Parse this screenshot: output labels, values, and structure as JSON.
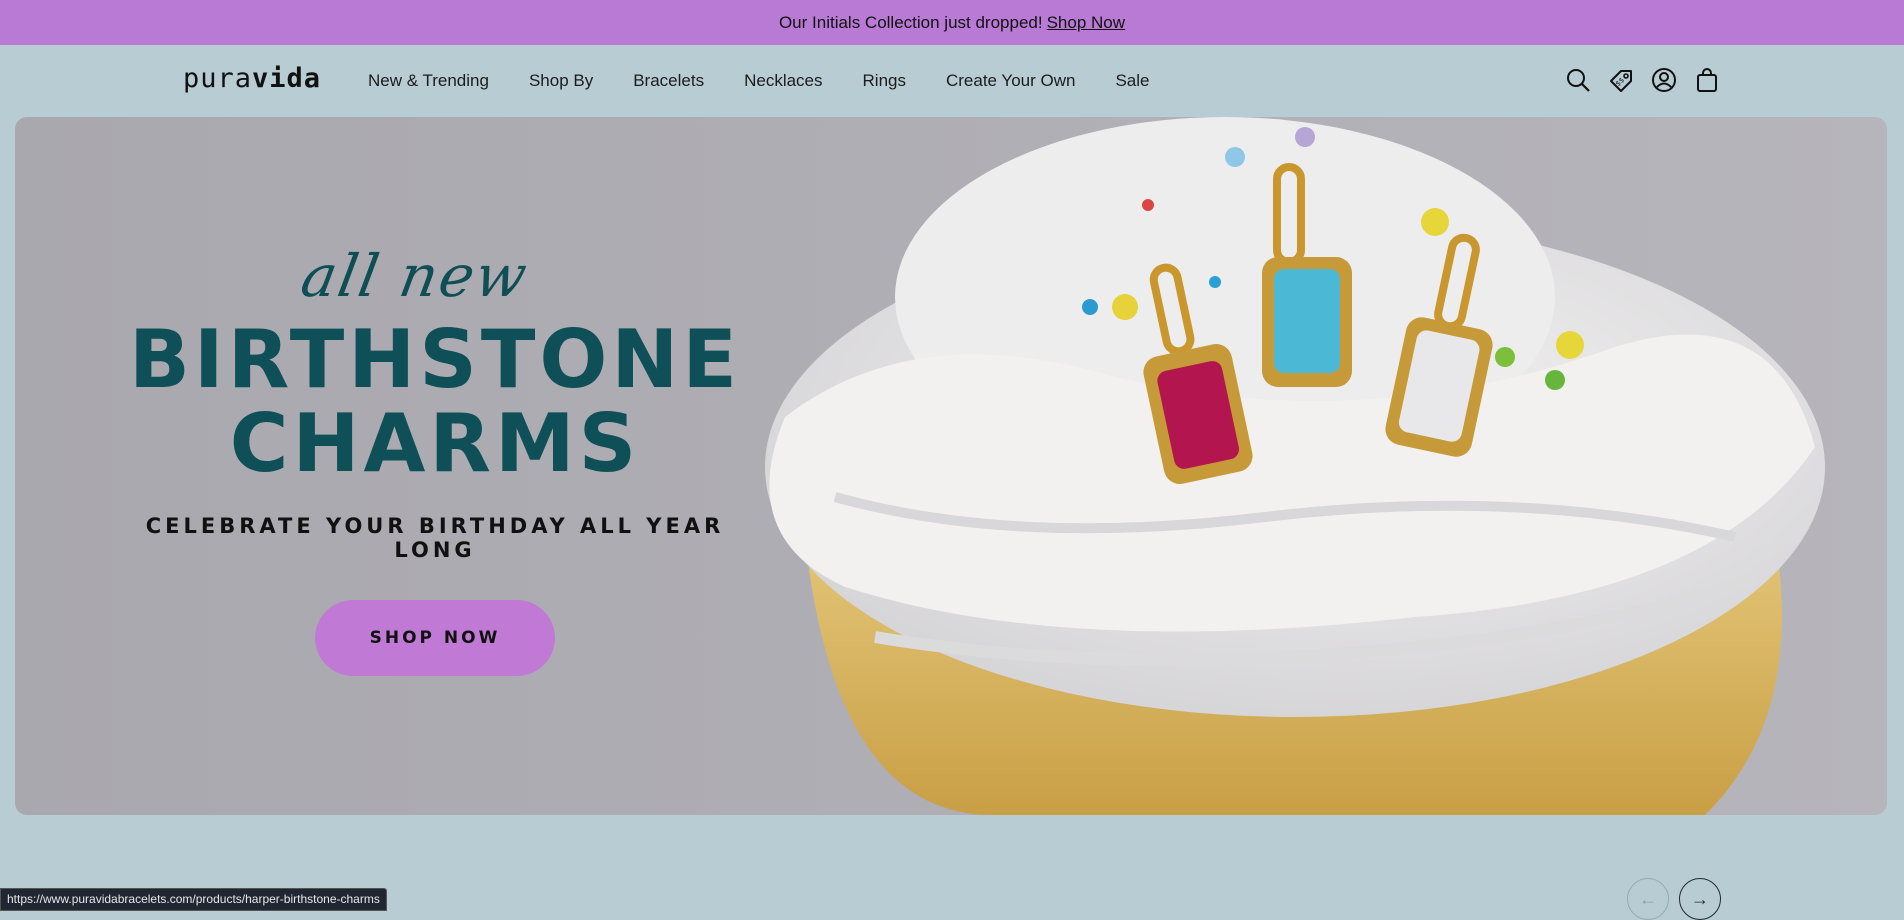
{
  "promo": {
    "text": "Our Initials Collection just dropped!",
    "link": "Shop Now"
  },
  "header": {
    "logo_light": "pura",
    "logo_bold": "vida",
    "nav": [
      "New & Trending",
      "Shop By",
      "Bracelets",
      "Necklaces",
      "Rings",
      "Create Your Own",
      "Sale"
    ],
    "icons": [
      "search-icon",
      "tag-icon",
      "account-icon",
      "bag-icon"
    ]
  },
  "hero": {
    "eyebrow": "all new",
    "headline_line1": "BIRTHSTONE",
    "headline_line2": "CHARMS",
    "subline": "CELEBRATE YOUR BIRTHDAY ALL YEAR LONG",
    "cta": "SHOP NOW"
  },
  "carousel": {
    "prev": "←",
    "next": "→"
  },
  "status_url": "https://www.puravidabracelets.com/products/harper-birthstone-charms",
  "colors": {
    "promo_bg": "#b97ad6",
    "page_bg": "#b8ccd3",
    "headline": "#0f5058",
    "cta_bg": "#c07ad5"
  }
}
